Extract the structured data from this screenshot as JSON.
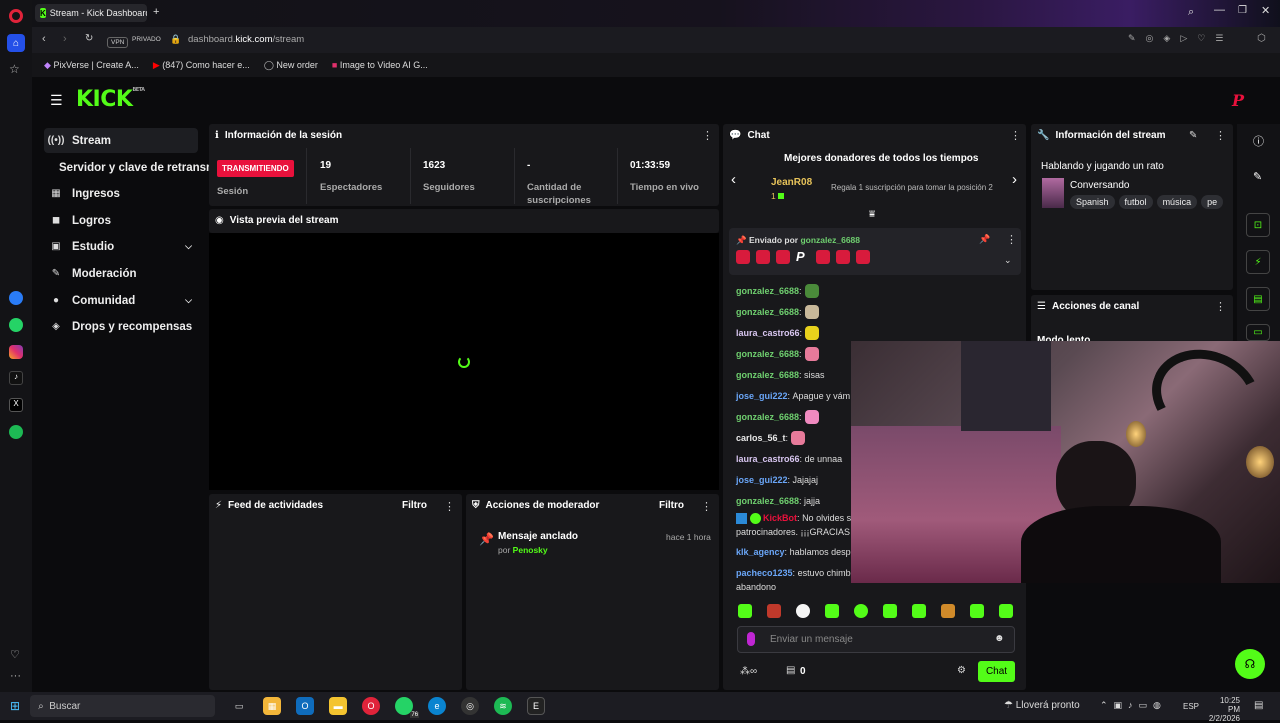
{
  "browser": {
    "tab_title": "Stream - Kick Dashboard",
    "url_domain": "dashboard.",
    "url_host": "kick.com",
    "url_path": "/stream",
    "vpn": "VPN",
    "private": "PRIVADO",
    "bookmarks": [
      "PixVerse | Create A...",
      "(847) Como hacer e...",
      "New order",
      "Image to Video AI G..."
    ]
  },
  "kick": {
    "logo": "KICK",
    "logo_sup": "BETA",
    "nav": [
      {
        "label": "Stream",
        "icon": "radio-icon"
      },
      {
        "label": "Servidor y clave de retransm",
        "icon": ""
      },
      {
        "label": "Ingresos",
        "icon": "money-icon"
      },
      {
        "label": "Logros",
        "icon": "trophy-icon"
      },
      {
        "label": "Estudio",
        "icon": "video-icon"
      },
      {
        "label": "Moderación",
        "icon": "wrench-icon"
      },
      {
        "label": "Comunidad",
        "icon": "users-icon"
      },
      {
        "label": "Drops y recompensas",
        "icon": "gift-icon"
      }
    ]
  },
  "session": {
    "title": "Información de la sesión",
    "live_badge": "TRANSMITIENDO",
    "session_label": "Sesión",
    "stats": [
      {
        "value": "19",
        "label": "Espectadores"
      },
      {
        "value": "1623",
        "label": "Seguidores"
      },
      {
        "value": "-",
        "label": "Cantidad de suscripciones"
      },
      {
        "value": "01:33:59",
        "label": "Tiempo en vivo"
      }
    ]
  },
  "preview": {
    "title": "Vista previa del stream"
  },
  "feed": {
    "title": "Feed de actividades",
    "filter": "Filtro"
  },
  "modactions": {
    "title": "Acciones de moderador",
    "filter": "Filtro",
    "item_title": "Mensaje anclado",
    "item_by": "por",
    "item_user": "Penosky",
    "item_time": "hace 1 hora"
  },
  "chat": {
    "title": "Chat",
    "donors_title": "Mejores donadores de todos los tiempos",
    "donor_name": "JeanR08",
    "donor_count": "1",
    "donor_cta": "Regala 1 suscripción para tomar la posición 2",
    "pinned_label": "Enviado por",
    "pinned_user": "gonzalez_6688",
    "messages": [
      {
        "user": "gonzalez_6688",
        "text": "",
        "color": "#6fcf6f"
      },
      {
        "user": "gonzalez_6688",
        "text": "",
        "color": "#6fcf6f"
      },
      {
        "user": "laura_castro66",
        "text": "",
        "color": "#d8c6f0"
      },
      {
        "user": "gonzalez_6688",
        "text": "",
        "color": "#6fcf6f"
      },
      {
        "user": "gonzalez_6688",
        "text": "sisas",
        "color": "#6fcf6f"
      },
      {
        "user": "jose_gui222",
        "text": "Apague y vám",
        "color": "#6aa6f8"
      },
      {
        "user": "gonzalez_6688",
        "text": "",
        "color": "#6fcf6f"
      },
      {
        "user": "carlos_56_t",
        "text": "",
        "color": "#e8e8e8"
      },
      {
        "user": "laura_castro66",
        "text": "de unnaa",
        "color": "#d8c6f0"
      },
      {
        "user": "jose_gui222",
        "text": "Jajajaj",
        "color": "#6aa6f8"
      },
      {
        "user": "gonzalez_6688",
        "text": "jajja",
        "color": "#6fcf6f"
      }
    ],
    "bot_user": "KickBot",
    "bot_text": "No olvides s",
    "bot_text2": "patrocinadores. ¡¡¡GRACIAS",
    "msg_agency_user": "klk_agency",
    "msg_agency_text": "hablamos desp",
    "msg_pacheco_user": "pacheco1235",
    "msg_pacheco_text": "estuvo chimb",
    "msg_pacheco_text2": "abandono",
    "input_placeholder": "Enviar un mensaje",
    "points": "0",
    "send_label": "Chat"
  },
  "stream_info": {
    "title": "Información del stream",
    "stream_title": "Hablando y jugando un rato",
    "category": "Conversando",
    "tags": [
      "Spanish",
      "futbol",
      "música",
      "pe"
    ]
  },
  "channel_actions": {
    "title": "Acciones de canal",
    "first_item": "Modo lento"
  },
  "taskbar": {
    "search": "Buscar",
    "weather": "Lloverá pronto",
    "lang": "ESP",
    "time": "10:25 PM",
    "date": "2/2/2026",
    "whatsapp_badge": "76"
  },
  "colors": {
    "accent": "#53fc18",
    "live": "#e9113c",
    "panel": "#18181b"
  }
}
